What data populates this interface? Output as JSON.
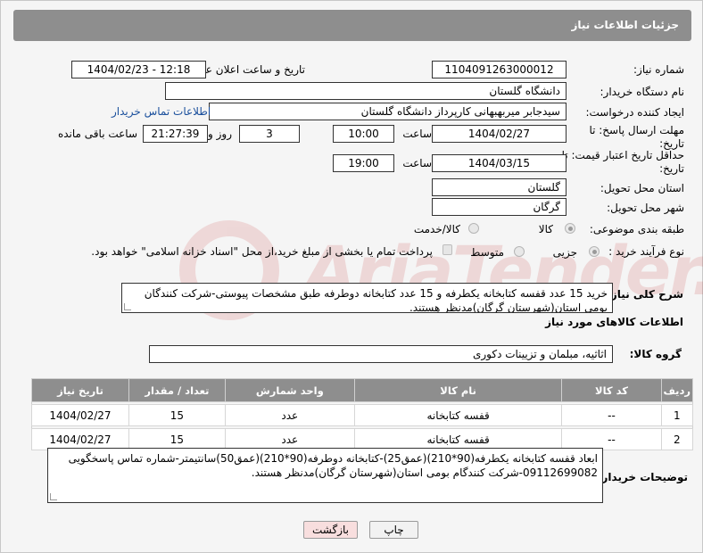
{
  "header": {
    "title": "جزئیات اطلاعات نیاز"
  },
  "fields": {
    "need_number_label": "شماره نیاز:",
    "need_number": "1104091263000012",
    "announce_label": "تاریخ و ساعت اعلان عمومی:",
    "announce_value": "1404/02/23 - 12:18",
    "buyer_org_label": "نام دستگاه خریدار:",
    "buyer_org": "دانشگاه گلستان",
    "creator_label": "ایجاد کننده درخواست:",
    "creator": "سیدجابر میربهبهانی کارپرداز دانشگاه گلستان",
    "contact_link": "اطلاعات تماس خریدار",
    "reply_deadline_label": "مهلت ارسال پاسخ: تا تاریخ:",
    "reply_date": "1404/02/27",
    "time_label": "ساعت",
    "reply_time": "10:00",
    "days_value": "3",
    "days_label": "روز و",
    "remaining_value": "21:27:39",
    "remaining_label": "ساعت باقی مانده",
    "price_validity_label": "حداقل تاریخ اعتبار قیمت: تا تاریخ:",
    "price_date": "1404/03/15",
    "price_time": "19:00",
    "province_label": "استان محل تحویل:",
    "province": "گلستان",
    "city_label": "شهر محل تحویل:",
    "city": "گرگان",
    "category_label": "طبقه بندی موضوعی:",
    "category_goods": "کالا",
    "category_goods_service": "کالا/خدمت",
    "process_label": "نوع فرآیند خرید :",
    "process_partial": "جزیی",
    "process_medium": "متوسط",
    "payment_note": "پرداخت تمام یا بخشی از مبلغ خرید،از محل \"اسناد خزانه اسلامی\" خواهد بود."
  },
  "summary": {
    "label": "شرح کلی نیاز:",
    "text": "خرید 15 عدد قفسه کتابخانه یکطرفه و 15 عدد کتابخانه دوطرفه طبق مشخصات پیوستی-شرکت کنندگان بومی استان(شهرستان گرگان)مدنظر هستند."
  },
  "goods_info": {
    "title": "اطلاعات کالاهای مورد نیاز",
    "group_label": "گروه کالا:",
    "group_value": "اثاثیه، مبلمان و تزیینات دکوری"
  },
  "table": {
    "headers": [
      "ردیف",
      "کد کالا",
      "نام کالا",
      "واحد شمارش",
      "تعداد / مقدار",
      "تاریخ نیاز"
    ],
    "rows": [
      [
        "1",
        "--",
        "قفسه کتابخانه",
        "عدد",
        "15",
        "1404/02/27"
      ],
      [
        "2",
        "--",
        "قفسه کتابخانه",
        "عدد",
        "15",
        "1404/02/27"
      ]
    ]
  },
  "buyer_notes": {
    "label": "توضیحات خریدار:",
    "text": "ابعاد قفسه کتابخانه یکطرفه(90*210)(عمق25)-کتابخانه دوطرفه(90*210)(عمق50)سانتیمتر-شماره تماس پاسخگویی 09112699082-شرکت کنندگام بومی استان(شهرستان گرگان)مدنظر هستند."
  },
  "buttons": {
    "print": "چاپ",
    "back": "بازگشت"
  },
  "watermark": {
    "text": "AriaTender.neT"
  },
  "colors": {
    "header_bg": "#8e8e8e",
    "link": "#1a4f9c",
    "back_button_bg": "#f8dede"
  }
}
